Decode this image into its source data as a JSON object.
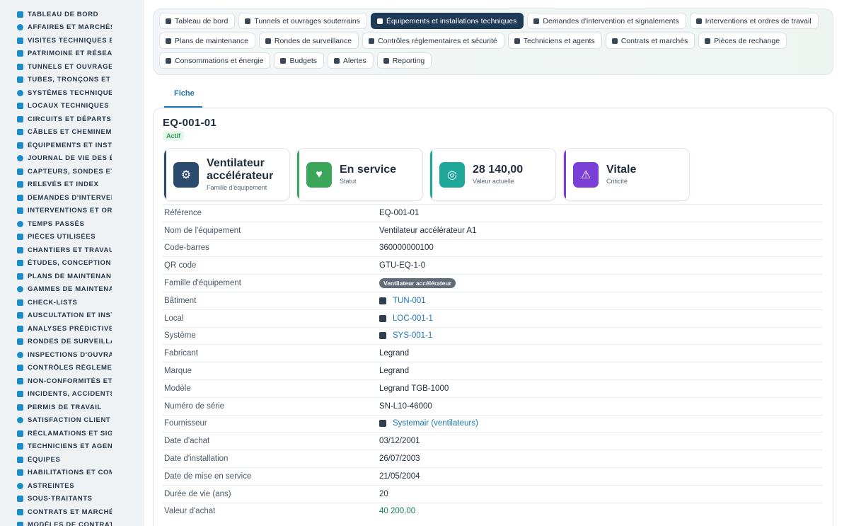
{
  "sidebar": {
    "items": [
      {
        "label": "TABLEAU DE BORD",
        "icon": "dashboard-icon"
      },
      {
        "label": "AFFAIRES ET MARCHÉS",
        "icon": "target-icon"
      },
      {
        "label": "VISITES TECHNIQUES ET",
        "icon": "walk-icon"
      },
      {
        "label": "PATRIMOINE ET RÉSEAUX",
        "icon": "map-icon"
      },
      {
        "label": "TUNNELS ET OUVRAGES",
        "icon": "tunnel-icon"
      },
      {
        "label": "TUBES, TRONÇONS ET ZO",
        "icon": "road-icon"
      },
      {
        "label": "SYSTÈMES TECHNIQUES",
        "icon": "sitemap-icon"
      },
      {
        "label": "LOCAUX TECHNIQUES ET",
        "icon": "grid-icon"
      },
      {
        "label": "CIRCUITS ET DÉPARTS É",
        "icon": "circuit-icon"
      },
      {
        "label": "CÂBLES ET CHEMINEMEN",
        "icon": "cable-icon"
      },
      {
        "label": "ÉQUIPEMENTS ET INSTAL",
        "icon": "cogs-icon"
      },
      {
        "label": "JOURNAL DE VIE DES ÉQ",
        "icon": "history-icon"
      },
      {
        "label": "CAPTEURS, SONDES ET C",
        "icon": "gauge-icon"
      },
      {
        "label": "RELEVÉS ET INDEX",
        "icon": "list-icon"
      },
      {
        "label": "DEMANDES D'INTERVENT",
        "icon": "help-icon"
      },
      {
        "label": "INTERVENTIONS ET ORDI",
        "icon": "clipboard-icon"
      },
      {
        "label": "TEMPS PASSÉS",
        "icon": "clock-icon"
      },
      {
        "label": "PIÈCES UTILISÉES",
        "icon": "puzzle-icon"
      },
      {
        "label": "CHANTIERS ET TRAVAUX",
        "icon": "hammer-icon"
      },
      {
        "label": "ÉTUDES, CONCEPTION ET",
        "icon": "file-icon"
      },
      {
        "label": "PLANS DE MAINTENANCE",
        "icon": "calendar-icon"
      },
      {
        "label": "GAMMES DE MAINTENAN",
        "icon": "layers-icon"
      },
      {
        "label": "CHECK-LISTS",
        "icon": "checklist-icon"
      },
      {
        "label": "AUSCULTATION ET INSTR",
        "icon": "thermometer-icon"
      },
      {
        "label": "ANALYSES PRÉDICTIVES",
        "icon": "chart-icon"
      },
      {
        "label": "RONDES DE SURVEILLAN",
        "icon": "route-icon"
      },
      {
        "label": "INSPECTIONS D'OUVRAG",
        "icon": "search-icon"
      },
      {
        "label": "CONTRÔLES RÉGLEMENT",
        "icon": "clipboard-check-icon"
      },
      {
        "label": "NON-CONFORMITÉS ET A",
        "icon": "alert-circle-icon"
      },
      {
        "label": "INCIDENTS, ACCIDENTS E",
        "icon": "warning-icon"
      },
      {
        "label": "PERMIS DE TRAVAIL",
        "icon": "signature-icon"
      },
      {
        "label": "SATISFACTION CLIENT",
        "icon": "smile-icon"
      },
      {
        "label": "RÉCLAMATIONS ET SIGN/",
        "icon": "comment-icon"
      },
      {
        "label": "TECHNICIENS ET AGENTS",
        "icon": "helmet-icon"
      },
      {
        "label": "ÉQUIPES",
        "icon": "users-icon"
      },
      {
        "label": "HABILITATIONS ET COMP",
        "icon": "badge-icon"
      },
      {
        "label": "ASTREINTES",
        "icon": "phone-icon"
      },
      {
        "label": "SOUS-TRAITANTS",
        "icon": "handshake-icon"
      },
      {
        "label": "CONTRATS ET MARCHÉS",
        "icon": "contract-icon"
      },
      {
        "label": "MODÈLES DE CONTRATS",
        "icon": "template-icon"
      }
    ]
  },
  "tabs": {
    "row1": [
      {
        "label": "Tableau de bord",
        "icon": "dashboard-icon",
        "active": false
      },
      {
        "label": "Tunnels et ouvrages souterrains",
        "icon": "building-icon",
        "active": false
      },
      {
        "label": "Équipements et installations techniques",
        "icon": "cogs-icon",
        "active": true
      },
      {
        "label": "Demandes d'intervention et signalements",
        "icon": "help-icon",
        "active": false
      },
      {
        "label": "Interventions et ordres de travail",
        "icon": "clipboard-icon",
        "active": false
      }
    ],
    "row2": [
      {
        "label": "Plans de maintenance",
        "icon": "calendar-icon",
        "active": false
      },
      {
        "label": "Rondes de surveillance",
        "icon": "route-icon",
        "active": false
      },
      {
        "label": "Contrôles réglementaires et sécurité",
        "icon": "clipboard-check-icon",
        "active": false
      },
      {
        "label": "Techniciens et agents",
        "icon": "helmet-icon",
        "active": false
      },
      {
        "label": "Contrats et marchés",
        "icon": "contract-icon",
        "active": false
      },
      {
        "label": "Pièces de rechange",
        "icon": "sitemap-icon",
        "active": false
      }
    ],
    "row3": [
      {
        "label": "Consommations et énergie",
        "icon": "bolt-icon",
        "active": false
      },
      {
        "label": "Budgets",
        "icon": "money-icon",
        "active": false
      },
      {
        "label": "Alertes",
        "icon": "bell-icon",
        "active": false
      },
      {
        "label": "Reporting",
        "icon": "pie-icon",
        "active": false
      }
    ]
  },
  "subtab": {
    "label": "Fiche"
  },
  "equipment": {
    "code": "EQ-001-01",
    "status_badge": "Actif"
  },
  "kpis": [
    {
      "value": "Ventilateur accélérateur",
      "label": "Famille d'équipement",
      "icon": "cogs-icon",
      "color": "#2a4a6e"
    },
    {
      "value": "En service",
      "label": "Statut",
      "icon": "heartbeat-icon",
      "color": "#3aa65a"
    },
    {
      "value": "28 140,00",
      "label": "Valeur actuelle",
      "icon": "coins-icon",
      "color": "#1fa89a"
    },
    {
      "value": "Vitale",
      "label": "Criticité",
      "icon": "warning-icon",
      "color": "#7a3fd6"
    }
  ],
  "details": [
    {
      "label": "Référence",
      "value": "EQ-001-01",
      "kind": "text"
    },
    {
      "label": "Nom de l'équipement",
      "value": "Ventilateur accélérateur A1",
      "kind": "text"
    },
    {
      "label": "Code-barres",
      "value": "360000000100",
      "kind": "text"
    },
    {
      "label": "QR code",
      "value": "GTU-EQ-1-0",
      "kind": "text"
    },
    {
      "label": "Famille d'équipement",
      "value": "Ventilateur accélérateur",
      "kind": "pill"
    },
    {
      "label": "Bâtiment",
      "value": "TUN-001",
      "kind": "link",
      "icon": "tunnel-icon"
    },
    {
      "label": "Local",
      "value": "LOC-001-1",
      "kind": "link",
      "icon": "tunnel-icon"
    },
    {
      "label": "Système",
      "value": "SYS-001-1",
      "kind": "link",
      "icon": "tunnel-icon"
    },
    {
      "label": "Fabricant",
      "value": "Legrand",
      "kind": "text"
    },
    {
      "label": "Marque",
      "value": "Legrand",
      "kind": "text"
    },
    {
      "label": "Modèle",
      "value": "Legrand TGB-1000",
      "kind": "text"
    },
    {
      "label": "Numéro de série",
      "value": "SN-L10-46000",
      "kind": "text"
    },
    {
      "label": "Fournisseur",
      "value": "Systemair (ventilateurs)",
      "kind": "link",
      "icon": "building-icon"
    },
    {
      "label": "Date d'achat",
      "value": "03/12/2001",
      "kind": "text"
    },
    {
      "label": "Date d'installation",
      "value": "26/07/2003",
      "kind": "text"
    },
    {
      "label": "Date de mise en service",
      "value": "21/05/2004",
      "kind": "text"
    },
    {
      "label": "Durée de vie (ans)",
      "value": "20",
      "kind": "text"
    },
    {
      "label": "Valeur d'achat",
      "value": "40 200,00",
      "kind": "money"
    }
  ],
  "colors": {
    "accent": "#1a78b8",
    "active_tab": "#1e3a56",
    "sidebar_bg": "#eef2f5",
    "sidebar_icon": "#1b8cc7"
  }
}
